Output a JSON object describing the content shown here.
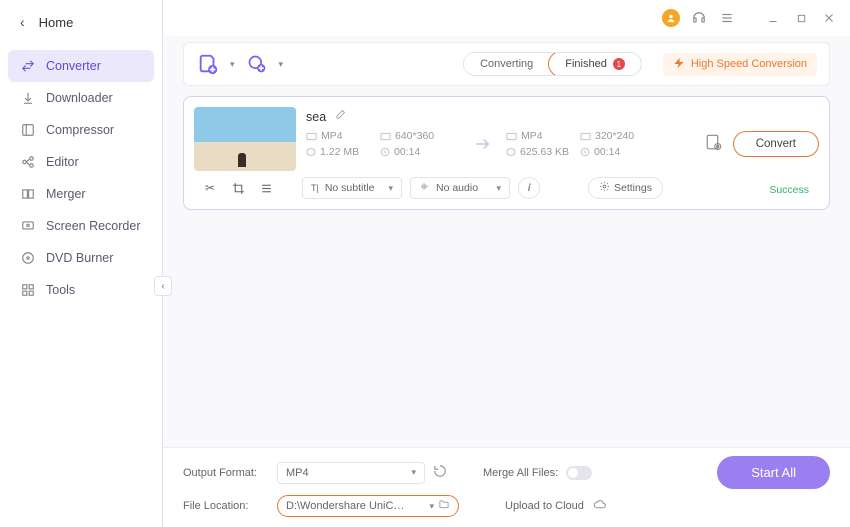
{
  "sidebar": {
    "home": "Home",
    "items": [
      {
        "label": "Converter"
      },
      {
        "label": "Downloader"
      },
      {
        "label": "Compressor"
      },
      {
        "label": "Editor"
      },
      {
        "label": "Merger"
      },
      {
        "label": "Screen Recorder"
      },
      {
        "label": "DVD Burner"
      },
      {
        "label": "Tools"
      }
    ]
  },
  "tabs": {
    "converting": "Converting",
    "finished": "Finished",
    "finished_count": "1"
  },
  "hsc": "High Speed Conversion",
  "file": {
    "name": "sea",
    "src": {
      "format": "MP4",
      "res": "640*360",
      "size": "1.22 MB",
      "dur": "00:14"
    },
    "dst": {
      "format": "MP4",
      "res": "320*240",
      "size": "625.63 KB",
      "dur": "00:14"
    },
    "subtitle": "No subtitle",
    "audio": "No audio",
    "settings_label": "Settings",
    "convert_label": "Convert",
    "status": "Success"
  },
  "footer": {
    "output_format_label": "Output Format:",
    "output_format": "MP4",
    "merge_label": "Merge All Files:",
    "file_location_label": "File Location:",
    "file_location": "D:\\Wondershare UniConverter 1",
    "upload_label": "Upload to Cloud",
    "start_all": "Start All"
  }
}
